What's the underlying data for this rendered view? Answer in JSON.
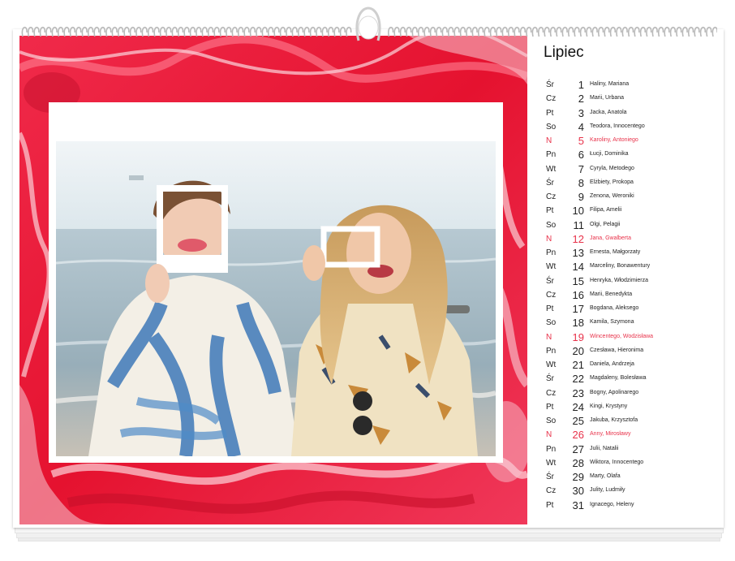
{
  "calendar": {
    "month": "Lipiec",
    "days": [
      {
        "wd": "Śr",
        "num": "1",
        "names": "Haliny, Mariana",
        "sunday": false
      },
      {
        "wd": "Cz",
        "num": "2",
        "names": "Marii, Urbana",
        "sunday": false
      },
      {
        "wd": "Pt",
        "num": "3",
        "names": "Jacka, Anatola",
        "sunday": false
      },
      {
        "wd": "So",
        "num": "4",
        "names": "Teodora, Innocentego",
        "sunday": false
      },
      {
        "wd": "N",
        "num": "5",
        "names": "Karoliny, Antoniego",
        "sunday": true
      },
      {
        "wd": "Pn",
        "num": "6",
        "names": "Łucji, Dominika",
        "sunday": false
      },
      {
        "wd": "Wt",
        "num": "7",
        "names": "Cyryla, Metodego",
        "sunday": false
      },
      {
        "wd": "Śr",
        "num": "8",
        "names": "Elżbiety, Prokopa",
        "sunday": false
      },
      {
        "wd": "Cz",
        "num": "9",
        "names": "Zenona, Weroniki",
        "sunday": false
      },
      {
        "wd": "Pt",
        "num": "10",
        "names": "Filipa, Amelii",
        "sunday": false
      },
      {
        "wd": "So",
        "num": "11",
        "names": "Olgi, Pelagii",
        "sunday": false
      },
      {
        "wd": "N",
        "num": "12",
        "names": "Jana, Gwalberta",
        "sunday": true
      },
      {
        "wd": "Pn",
        "num": "13",
        "names": "Ernesta, Małgorzaty",
        "sunday": false
      },
      {
        "wd": "Wt",
        "num": "14",
        "names": "Marceliny, Bonawentury",
        "sunday": false
      },
      {
        "wd": "Śr",
        "num": "15",
        "names": "Henryka, Włodzimierza",
        "sunday": false
      },
      {
        "wd": "Cz",
        "num": "16",
        "names": "Marii, Benedykta",
        "sunday": false
      },
      {
        "wd": "Pt",
        "num": "17",
        "names": "Bogdana, Aleksego",
        "sunday": false
      },
      {
        "wd": "So",
        "num": "18",
        "names": "Kamila, Szymona",
        "sunday": false
      },
      {
        "wd": "N",
        "num": "19",
        "names": "Wincentego, Wodzisława",
        "sunday": true
      },
      {
        "wd": "Pn",
        "num": "20",
        "names": "Czesława, Hieronima",
        "sunday": false
      },
      {
        "wd": "Wt",
        "num": "21",
        "names": "Daniela, Andrzeja",
        "sunday": false
      },
      {
        "wd": "Śr",
        "num": "22",
        "names": "Magdaleny, Bolesława",
        "sunday": false
      },
      {
        "wd": "Cz",
        "num": "23",
        "names": "Bogny, Apolinarego",
        "sunday": false
      },
      {
        "wd": "Pt",
        "num": "24",
        "names": "Kingi, Krystyny",
        "sunday": false
      },
      {
        "wd": "So",
        "num": "25",
        "names": "Jakuba, Krzysztofa",
        "sunday": false
      },
      {
        "wd": "N",
        "num": "26",
        "names": "Anny, Mirosławy",
        "sunday": true
      },
      {
        "wd": "Pn",
        "num": "27",
        "names": "Julii, Natalii",
        "sunday": false
      },
      {
        "wd": "Wt",
        "num": "28",
        "names": "Wiktora, Innocentego",
        "sunday": false
      },
      {
        "wd": "Śr",
        "num": "29",
        "names": "Marty, Olafa",
        "sunday": false
      },
      {
        "wd": "Cz",
        "num": "30",
        "names": "Julity, Ludmiły",
        "sunday": false
      },
      {
        "wd": "Pt",
        "num": "31",
        "names": "Ignacego, Heleny",
        "sunday": false
      }
    ]
  },
  "colors": {
    "background_red": "#e8163b",
    "sunday_red": "#e8324a",
    "text": "#222222"
  },
  "icons": {
    "binding": "spiral-wire-binding",
    "hanger": "calendar-hanger-hook"
  }
}
